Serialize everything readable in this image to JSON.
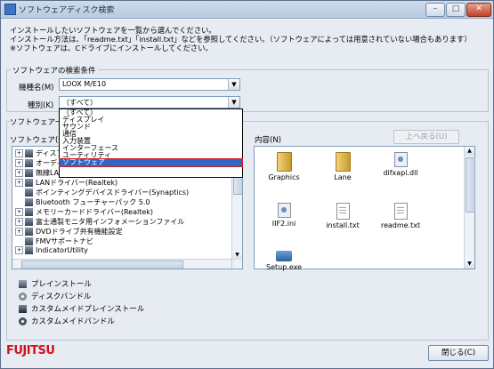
{
  "window": {
    "title": "ソフトウェアディスク検索",
    "min_label": "–",
    "max_label": "□",
    "close_label": "✕"
  },
  "intro": [
    "インストールしたいソフトウェアを一覧から選んでください。",
    "インストール方法は、「readme.txt」「install.txt」などを参照してください。（ソフトウェアによっては用意されていない場合もあります）",
    "※ソフトウェアは、Cドライブにインストールしてください。"
  ],
  "search": {
    "group_label": "ソフトウェアの検索条件",
    "model_label": "機種名(M)",
    "model_value": "LOOX M/E10",
    "type_label": "種別(K)",
    "type_value": "（すべて）",
    "options": [
      "（すべて）",
      "ディスプレイ",
      "サウンド",
      "通信",
      "入力装置",
      "インターフェース",
      "ユーティリティ",
      "ソフトウェア"
    ],
    "selected_option": "ソフトウェア"
  },
  "list": {
    "group_label": "ソフトウェア一覧",
    "tree_label": "ソフトウェア(Q)",
    "items": [
      {
        "label": "ディスプレイ"
      },
      {
        "label": "オーディオ"
      },
      {
        "label": "無線LAN"
      },
      {
        "label": "LANドライバー(Realtek)"
      },
      {
        "label": "ポインティングデバイスドライバー(Synaptics)"
      },
      {
        "label": "Bluetooth フューチャーパック 5.0"
      },
      {
        "label": "メモリーカードドライバー(Realtek)"
      },
      {
        "label": "富士通製モニタ用インフォメーションファイル"
      },
      {
        "label": "DVDドライブ共有機能設定"
      },
      {
        "label": "FMVサポートナビ"
      },
      {
        "label": "IndicatorUtility"
      }
    ]
  },
  "contents": {
    "label": "内容(N)",
    "up_button": "上へ戻る(U)",
    "files": [
      {
        "name": "Graphics",
        "kind": "folder-icon"
      },
      {
        "name": "Lane",
        "kind": "folder-icon"
      },
      {
        "name": "difxapi.dll",
        "kind": "dll-icon"
      },
      {
        "name": "IIF2.ini",
        "kind": "ini-icon"
      },
      {
        "name": "install.txt",
        "kind": "text-file-icon"
      },
      {
        "name": "readme.txt",
        "kind": "text-file-icon"
      },
      {
        "name": "Setup.exe",
        "kind": "setup-icon"
      }
    ]
  },
  "legend": [
    {
      "label": "プレインストール",
      "icon": "preinstall-icon"
    },
    {
      "label": "ディスクバンドル",
      "icon": "disc-icon"
    },
    {
      "label": "カスタムメイドプレインストール",
      "icon": "custom-preinstall-icon"
    },
    {
      "label": "カスタムメイドバンドル",
      "icon": "custom-disc-icon"
    }
  ],
  "footer": {
    "logo": "FUJITSU",
    "close_button": "閉じる(C)"
  }
}
